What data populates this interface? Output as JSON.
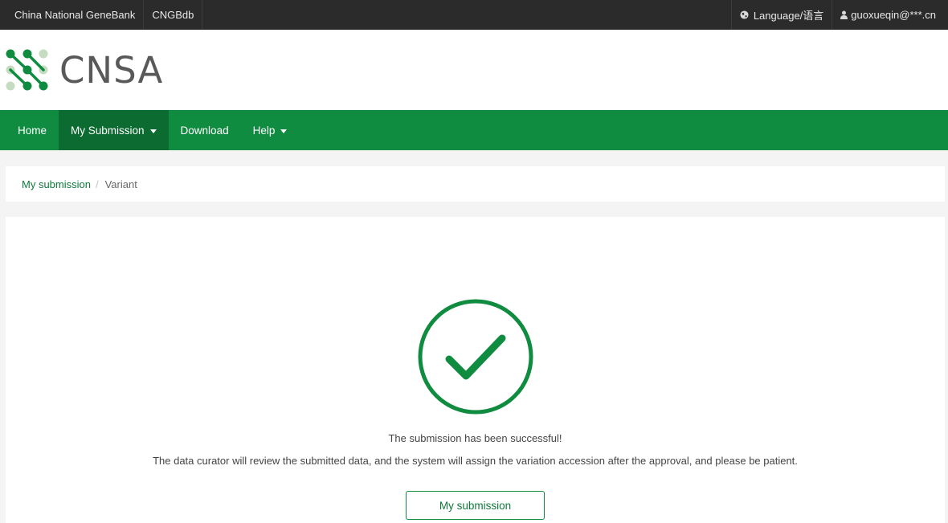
{
  "topbar": {
    "links": [
      "China National GeneBank",
      "CNGBdb"
    ],
    "language": "Language/语言",
    "user": "guoxueqin@***.cn"
  },
  "logo": {
    "text": "CNSA"
  },
  "nav": {
    "items": [
      {
        "label": "Home"
      },
      {
        "label": "My Submission",
        "has_dropdown": true,
        "active": true
      },
      {
        "label": "Download"
      },
      {
        "label": "Help",
        "has_dropdown": true
      }
    ]
  },
  "breadcrumb": {
    "link": "My submission",
    "separator": "/",
    "current": "Variant"
  },
  "main": {
    "icon": "check-circle-icon",
    "success_title": "The submission has been successful!",
    "success_detail": "The data curator will review the submitted data, and the system will assign the variation accession after the approval, and please be patient.",
    "button_label": "My submission"
  },
  "colors": {
    "topbar_bg": "#2b2b2b",
    "brand_green": "#0f8c40",
    "nav_active": "#0b6b31",
    "logo_light_green": "#c5dcc0"
  }
}
